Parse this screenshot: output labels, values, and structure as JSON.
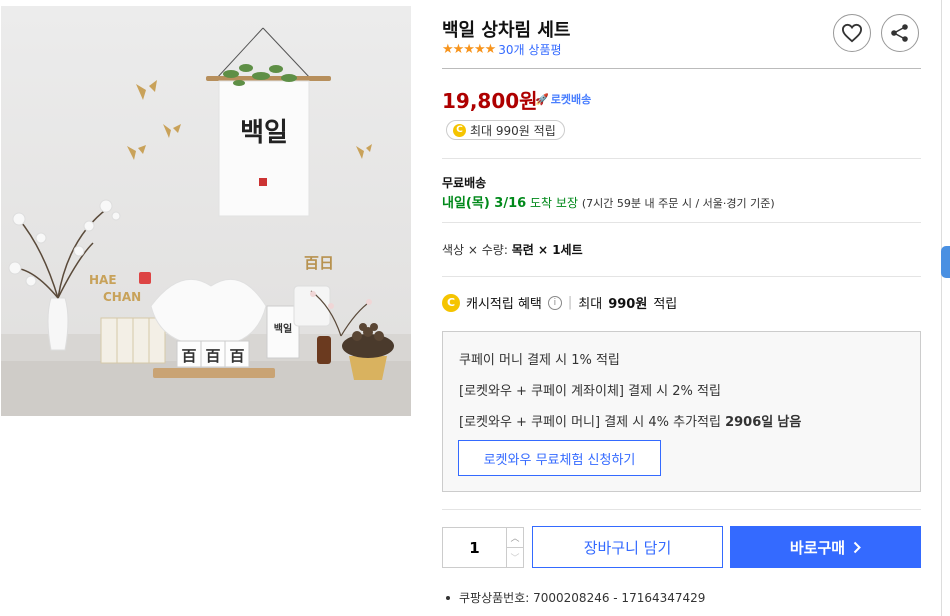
{
  "product": {
    "title": "백일 상차림 세트",
    "stars": "★★★★★",
    "review_count": "30개 상품평",
    "rating": 5,
    "price": "19,800원",
    "rocket_label": "로켓배송",
    "reward": "최대 990원 적립",
    "image_texts": {
      "banner": "백일",
      "blocks": "百",
      "topper": "百日",
      "hae": "HAE",
      "chan": "CHAN",
      "card": "백일"
    }
  },
  "shipping": {
    "label": "무료배송",
    "date": "내일(목) 3/16",
    "guarantee": "도착 보장",
    "condition": "(7시간 59분  내 주문 시 / 서울·경기 기준)"
  },
  "option": {
    "label": "색상 × 수량:",
    "value": "목련 × 1세트"
  },
  "cash": {
    "label": "캐시적립 혜택",
    "max": "최대",
    "amount": "990원",
    "suffix": "적립"
  },
  "benefits": {
    "line1": "쿠페이 머니 결제 시 1% 적립",
    "line2": "[로켓와우 + 쿠페이 계좌이체] 결제 시 2% 적립",
    "line3_prefix": "[로켓와우 + 쿠페이 머니] 결제 시 4% 추가적립",
    "line3_days": "2906일",
    "line3_suffix": "남음",
    "trial_button": "로켓와우 무료체험 신청하기"
  },
  "purchase": {
    "quantity": "1",
    "cart_button": "장바구니 담기",
    "buy_button": "바로구매"
  },
  "product_id": {
    "label": "쿠팡상품번호:",
    "value": "7000208246 - 17164347429"
  },
  "colors": {
    "price": "#ae0000",
    "accent": "#346aff",
    "shipping_green": "#00891a",
    "star": "#f7941d"
  }
}
